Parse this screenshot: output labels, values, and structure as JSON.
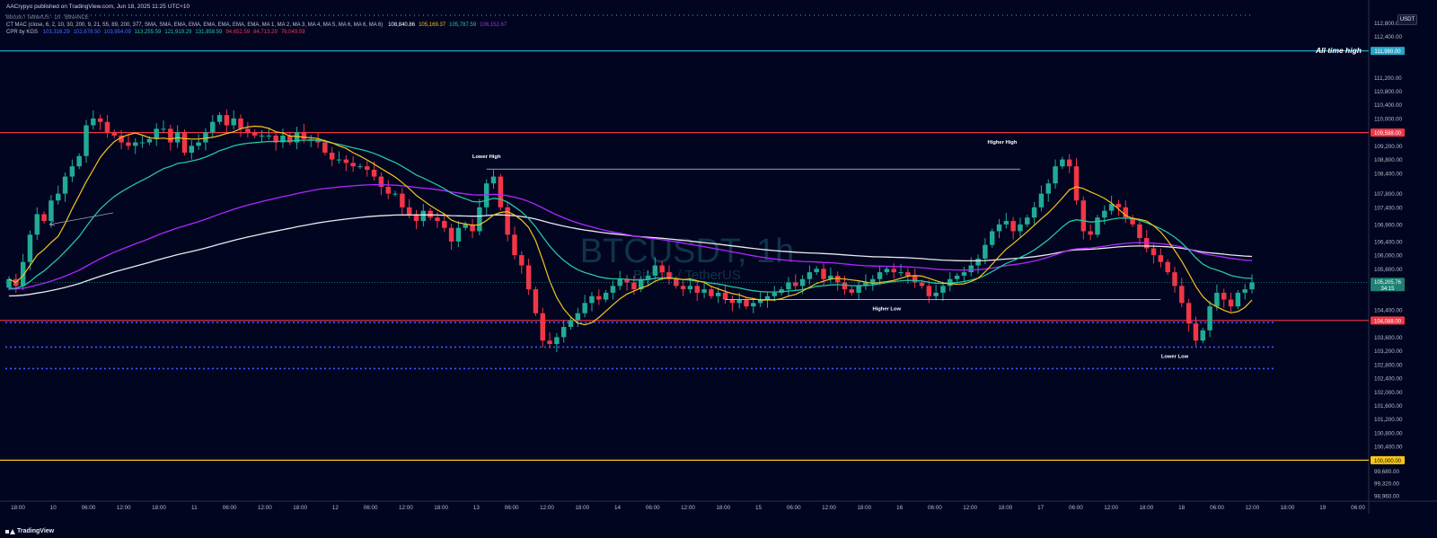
{
  "publisher_line": "AACrypyo published on TradingView.com, Jun 18, 2025 11:25 UTC+10",
  "brand": "TradingView",
  "currency_button": "USDT",
  "indicators": {
    "symbol_line": "Bitcoin / TetherUS · 1h · BINANCE",
    "ma_line": "CT MAC (close, 6, 2, 10, 30, 200, 9, 21, 55, 89, 200, 377, SMA, SMA, EMA, EMA, EMA, EMA, EMA, EMA, MA 1, MA 2, MA 3, MA 4, MA 5, MA 6, MA 6, MA 6)",
    "ma_values": [
      {
        "text": "108,840.86",
        "color": "#ffffff"
      },
      {
        "text": "105,169.37",
        "color": "#f5c518"
      },
      {
        "text": "105,787.59",
        "color": "#26c6a0"
      },
      {
        "text": "106,152.67",
        "color": "#b026ff"
      }
    ],
    "cpr_line": "CPR by KGS",
    "cpr_values": [
      {
        "text": "103,316.29",
        "color": "#4a6cff"
      },
      {
        "text": "102,678.50",
        "color": "#4a6cff"
      },
      {
        "text": "103,954.09",
        "color": "#4a6cff"
      },
      {
        "text": "113,255.59",
        "color": "#26c6a0"
      },
      {
        "text": "121,919.29",
        "color": "#26c6a0"
      },
      {
        "text": "131,858.59",
        "color": "#26c6a0"
      },
      {
        "text": "94,652.59",
        "color": "#f23645"
      },
      {
        "text": "84,713.29",
        "color": "#f23645"
      },
      {
        "text": "76,049.59",
        "color": "#f23645"
      }
    ]
  },
  "watermark": {
    "title": "BTCUSDT, 1h",
    "subtitle": "Bitcoin / TetherUS"
  },
  "chart_data": {
    "type": "candlestick",
    "title": "BTCUSDT, 1h",
    "y_axis": {
      "ticks": [
        "112,800.00",
        "112,400.00",
        "111,200.00",
        "110,800.00",
        "110,400.00",
        "110,000.00",
        "109,200.00",
        "108,800.00",
        "108,400.00",
        "107,800.00",
        "107,400.00",
        "106,900.00",
        "106,400.00",
        "106,000.00",
        "105,600.00",
        "105,200.00",
        "104,400.00",
        "103,600.00",
        "103,200.00",
        "102,800.00",
        "102,400.00",
        "102,000.00",
        "101,600.00",
        "101,200.00",
        "100,800.00",
        "100,400.00",
        "99,680.00",
        "99,320.00",
        "98,960.00"
      ],
      "range": [
        98800,
        113100
      ]
    },
    "x_axis": {
      "ticks": [
        "18:00",
        "10",
        "06:00",
        "12:00",
        "18:00",
        "11",
        "06:00",
        "12:00",
        "18:00",
        "12",
        "06:00",
        "12:00",
        "18:00",
        "13",
        "06:00",
        "12:00",
        "18:00",
        "14",
        "06:00",
        "12:00",
        "18:00",
        "15",
        "06:00",
        "12:00",
        "18:00",
        "16",
        "06:00",
        "12:00",
        "18:00",
        "17",
        "06:00",
        "12:00",
        "18:00",
        "18",
        "06:00",
        "12:00",
        "18:00",
        "19",
        "06:00"
      ]
    },
    "price_levels": [
      {
        "label": "111,980.00",
        "value": 111980,
        "color": "#26a5c8"
      },
      {
        "label": "109,588.00",
        "value": 109588,
        "color": "#f23645"
      },
      {
        "label": "104,088.00",
        "value": 104088,
        "color": "#f23645"
      },
      {
        "label": "100,000.00",
        "value": 100000,
        "color": "#f5c518"
      }
    ],
    "current_price": {
      "label": "105,205.76",
      "countdown": "34:15",
      "value": 105205.76
    },
    "dotted_levels": [
      104030,
      103310,
      102680
    ],
    "annotations": [
      {
        "text": "All time high",
        "at": 111980
      },
      {
        "text": "Lower High",
        "at": 108520
      },
      {
        "text": "Higher High",
        "at": 108520
      },
      {
        "text": "Higher Low",
        "at": 104700
      },
      {
        "text": "Lower Low",
        "at": 103310
      }
    ],
    "closes": [
      105300,
      105100,
      105800,
      106600,
      107200,
      107000,
      107600,
      107800,
      108300,
      108600,
      108900,
      109800,
      110000,
      109900,
      109600,
      109500,
      109300,
      109200,
      109300,
      109300,
      109400,
      109700,
      109700,
      109300,
      109600,
      109000,
      109200,
      109300,
      109600,
      109900,
      110100,
      109800,
      110000,
      109700,
      109600,
      109500,
      109500,
      109500,
      109300,
      109500,
      109300,
      109600,
      109400,
      109400,
      109300,
      109000,
      108800,
      108800,
      108700,
      108600,
      108600,
      108500,
      108300,
      108000,
      107800,
      107800,
      107400,
      107200,
      107000,
      107300,
      107100,
      107000,
      106800,
      106400,
      106800,
      106900,
      106700,
      107400,
      108100,
      108300,
      107400,
      106600,
      106000,
      105700,
      105000,
      104300,
      103500,
      103400,
      103600,
      103900,
      104100,
      104300,
      104600,
      104800,
      104700,
      104900,
      105100,
      105300,
      105200,
      105000,
      105300,
      105400,
      105700,
      105500,
      105300,
      105100,
      105000,
      105100,
      104900,
      105000,
      104800,
      104900,
      104700,
      104600,
      104700,
      104500,
      104600,
      104700,
      104800,
      104900,
      105000,
      105200,
      105100,
      105300,
      105500,
      105600,
      105300,
      105400,
      105200,
      105000,
      104900,
      105100,
      105200,
      105300,
      105500,
      105600,
      105500,
      105500,
      105400,
      105200,
      105100,
      104800,
      104900,
      105100,
      105300,
      105400,
      105500,
      105700,
      105900,
      106300,
      106700,
      106900,
      107000,
      106700,
      106900,
      107100,
      107400,
      107800,
      108100,
      108600,
      108800,
      108600,
      107600,
      106700,
      106600,
      107100,
      107300,
      107500,
      107400,
      107100,
      106900,
      106500,
      106200,
      106000,
      105800,
      105500,
      105100,
      104600,
      104000,
      103500,
      103800,
      104500,
      104900,
      104700,
      104500,
      104900,
      105000,
      105200
    ]
  }
}
